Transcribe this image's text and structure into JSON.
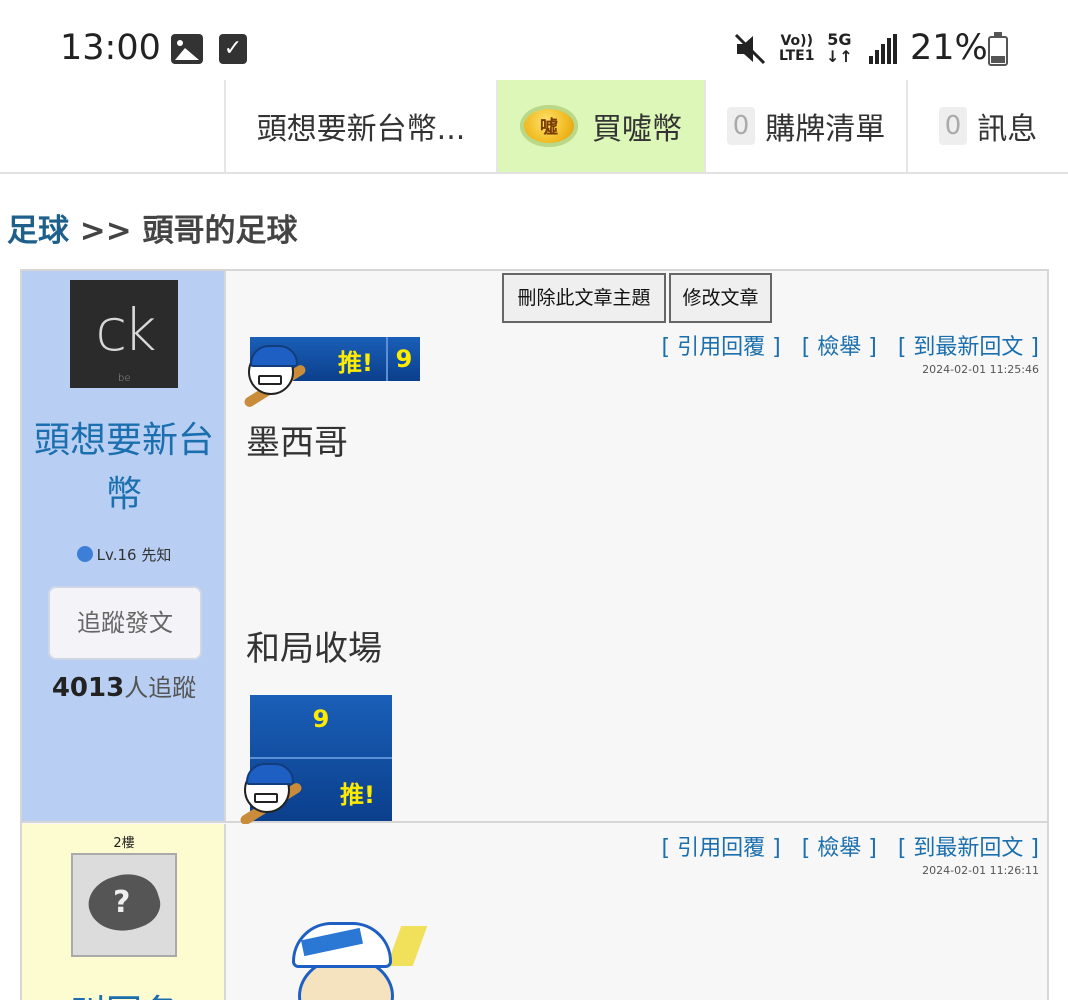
{
  "status_bar": {
    "time": "13:00",
    "volte_line1": "Vo))",
    "volte_line2": "LTE1",
    "network_line1": "5G",
    "network_line2": "↓↑",
    "battery_percent": "21%",
    "icons": [
      "image-icon",
      "check-icon",
      "mute-icon",
      "volte-icon",
      "5g-icon",
      "signal-icon",
      "battery-icon"
    ]
  },
  "nav": {
    "user_label": "頭想要新台幣...",
    "buy_coin_label": "買噓幣",
    "coin_icon_text": "噓",
    "cart_count": "0",
    "cart_label": "購牌清單",
    "message_count": "0",
    "message_label": "訊息"
  },
  "breadcrumb": {
    "section": "足球",
    "separator": " >> ",
    "topic": "頭哥的足球"
  },
  "posts": [
    {
      "floor": "",
      "author": {
        "avatar_text": "ck",
        "avatar_subtext": "be",
        "name": "頭想要新台幣",
        "level": "Lv.16 先知",
        "follow_label": "追蹤發文",
        "follower_count": "4013",
        "follower_suffix": "人追蹤"
      },
      "admin_buttons": {
        "delete_label": "刪除此文章主題",
        "edit_label": "修改文章"
      },
      "links": {
        "quote": "[ 引用回覆 ]",
        "report": "[ 檢舉 ]",
        "latest": "[ 到最新回文 ]"
      },
      "timestamp": "2024-02-01 11:25:46",
      "push_label": "推!",
      "push_count": "9",
      "content_lines": [
        "墨西哥",
        "和局收場"
      ],
      "bottom_push_count": "9",
      "bottom_push_label": "推!"
    },
    {
      "floor": "2樓",
      "author": {
        "avatar_text": "?",
        "name": "叫回名"
      },
      "links": {
        "quote": "[ 引用回覆 ]",
        "report": "[ 檢舉 ]",
        "latest": "[ 到最新回文 ]"
      },
      "timestamp": "2024-02-01 11:26:11"
    }
  ],
  "colors": {
    "author_bg": "#b8cff3",
    "reply_author_bg": "#fdfbd0",
    "link": "#1b6fae",
    "buy_coin_bg": "#dcf7b8",
    "push_yellow": "#ffeb00",
    "push_blue": "#0b3f8c"
  }
}
